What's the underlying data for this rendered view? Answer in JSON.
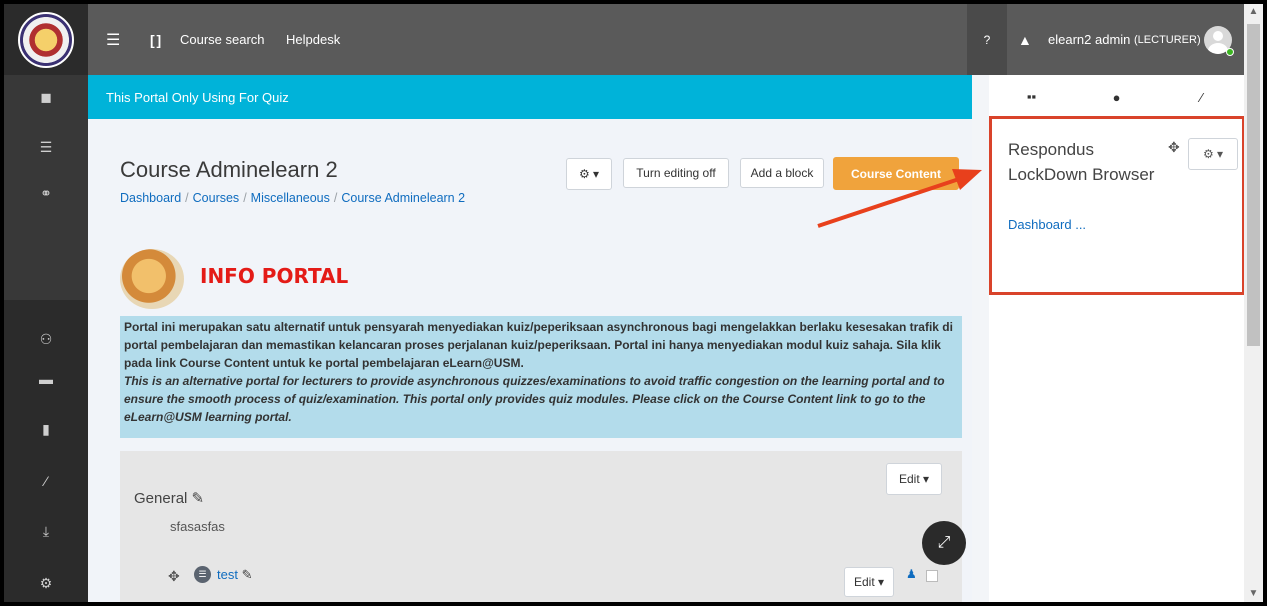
{
  "topbar": {
    "menu_icon": "hamburger-icon",
    "fullscreen_icon": "fullscreen-icon",
    "links": [
      "Course search",
      "Helpdesk"
    ],
    "help_icon": "question-circle-icon",
    "bell_icon": "bell-icon",
    "user_name": "elearn2 admin",
    "user_role": "(LECTURER)"
  },
  "leftbar": {
    "icons": [
      "book-icon",
      "list-icon",
      "link-icon",
      "users-icon",
      "archive-icon",
      "file-icon",
      "brush-icon",
      "download-icon",
      "cogs-icon"
    ]
  },
  "banner": {
    "text": "This Portal Only Using For Quiz"
  },
  "course": {
    "title": "Course Adminelearn 2",
    "breadcrumb": [
      "Dashboard",
      "Courses",
      "Miscellaneous",
      "Course Adminelearn 2"
    ],
    "breadcrumb_sep": "/",
    "buttons": {
      "turn_editing": "Turn editing off",
      "add_block": "Add a block",
      "course_content": "Course Content"
    }
  },
  "info": {
    "title": "INFO PORTAL",
    "malay": "Portal ini merupakan satu alternatif untuk pensyarah menyediakan kuiz/peperiksaan asynchronous bagi mengelakkan berlaku kesesakan trafik di portal pembelajaran dan memastikan kelancaran proses perjalanan kuiz/peperiksaan. Portal ini hanya menyediakan modul kuiz sahaja. Sila klik pada link Course Content untuk ke portal pembelajaran eLearn@USM.",
    "english": "This is an alternative portal for lecturers to provide asynchronous quizzes/examinations to avoid traffic congestion on the learning portal and to ensure the smooth process of quiz/examination. This portal only provides quiz modules. Please click on the Course Content link to go to the eLearn@USM learning portal."
  },
  "section": {
    "edit_label": "Edit",
    "title": "General",
    "summary": "sfasasfas",
    "activity_name": "test",
    "activity_edit_label": "Edit"
  },
  "drawer": {
    "tabs": [
      "blocks-icon",
      "comment-icon",
      "brush-icon"
    ],
    "block_title": "Respondus LockDown Browser",
    "block_link": "Dashboard ..."
  },
  "colors": {
    "banner": "#00b3d9",
    "accent_orange": "#f0a33c",
    "info_red": "#e41b17",
    "highlight_box": "#d9432a",
    "link_blue": "#0f6cbf"
  }
}
